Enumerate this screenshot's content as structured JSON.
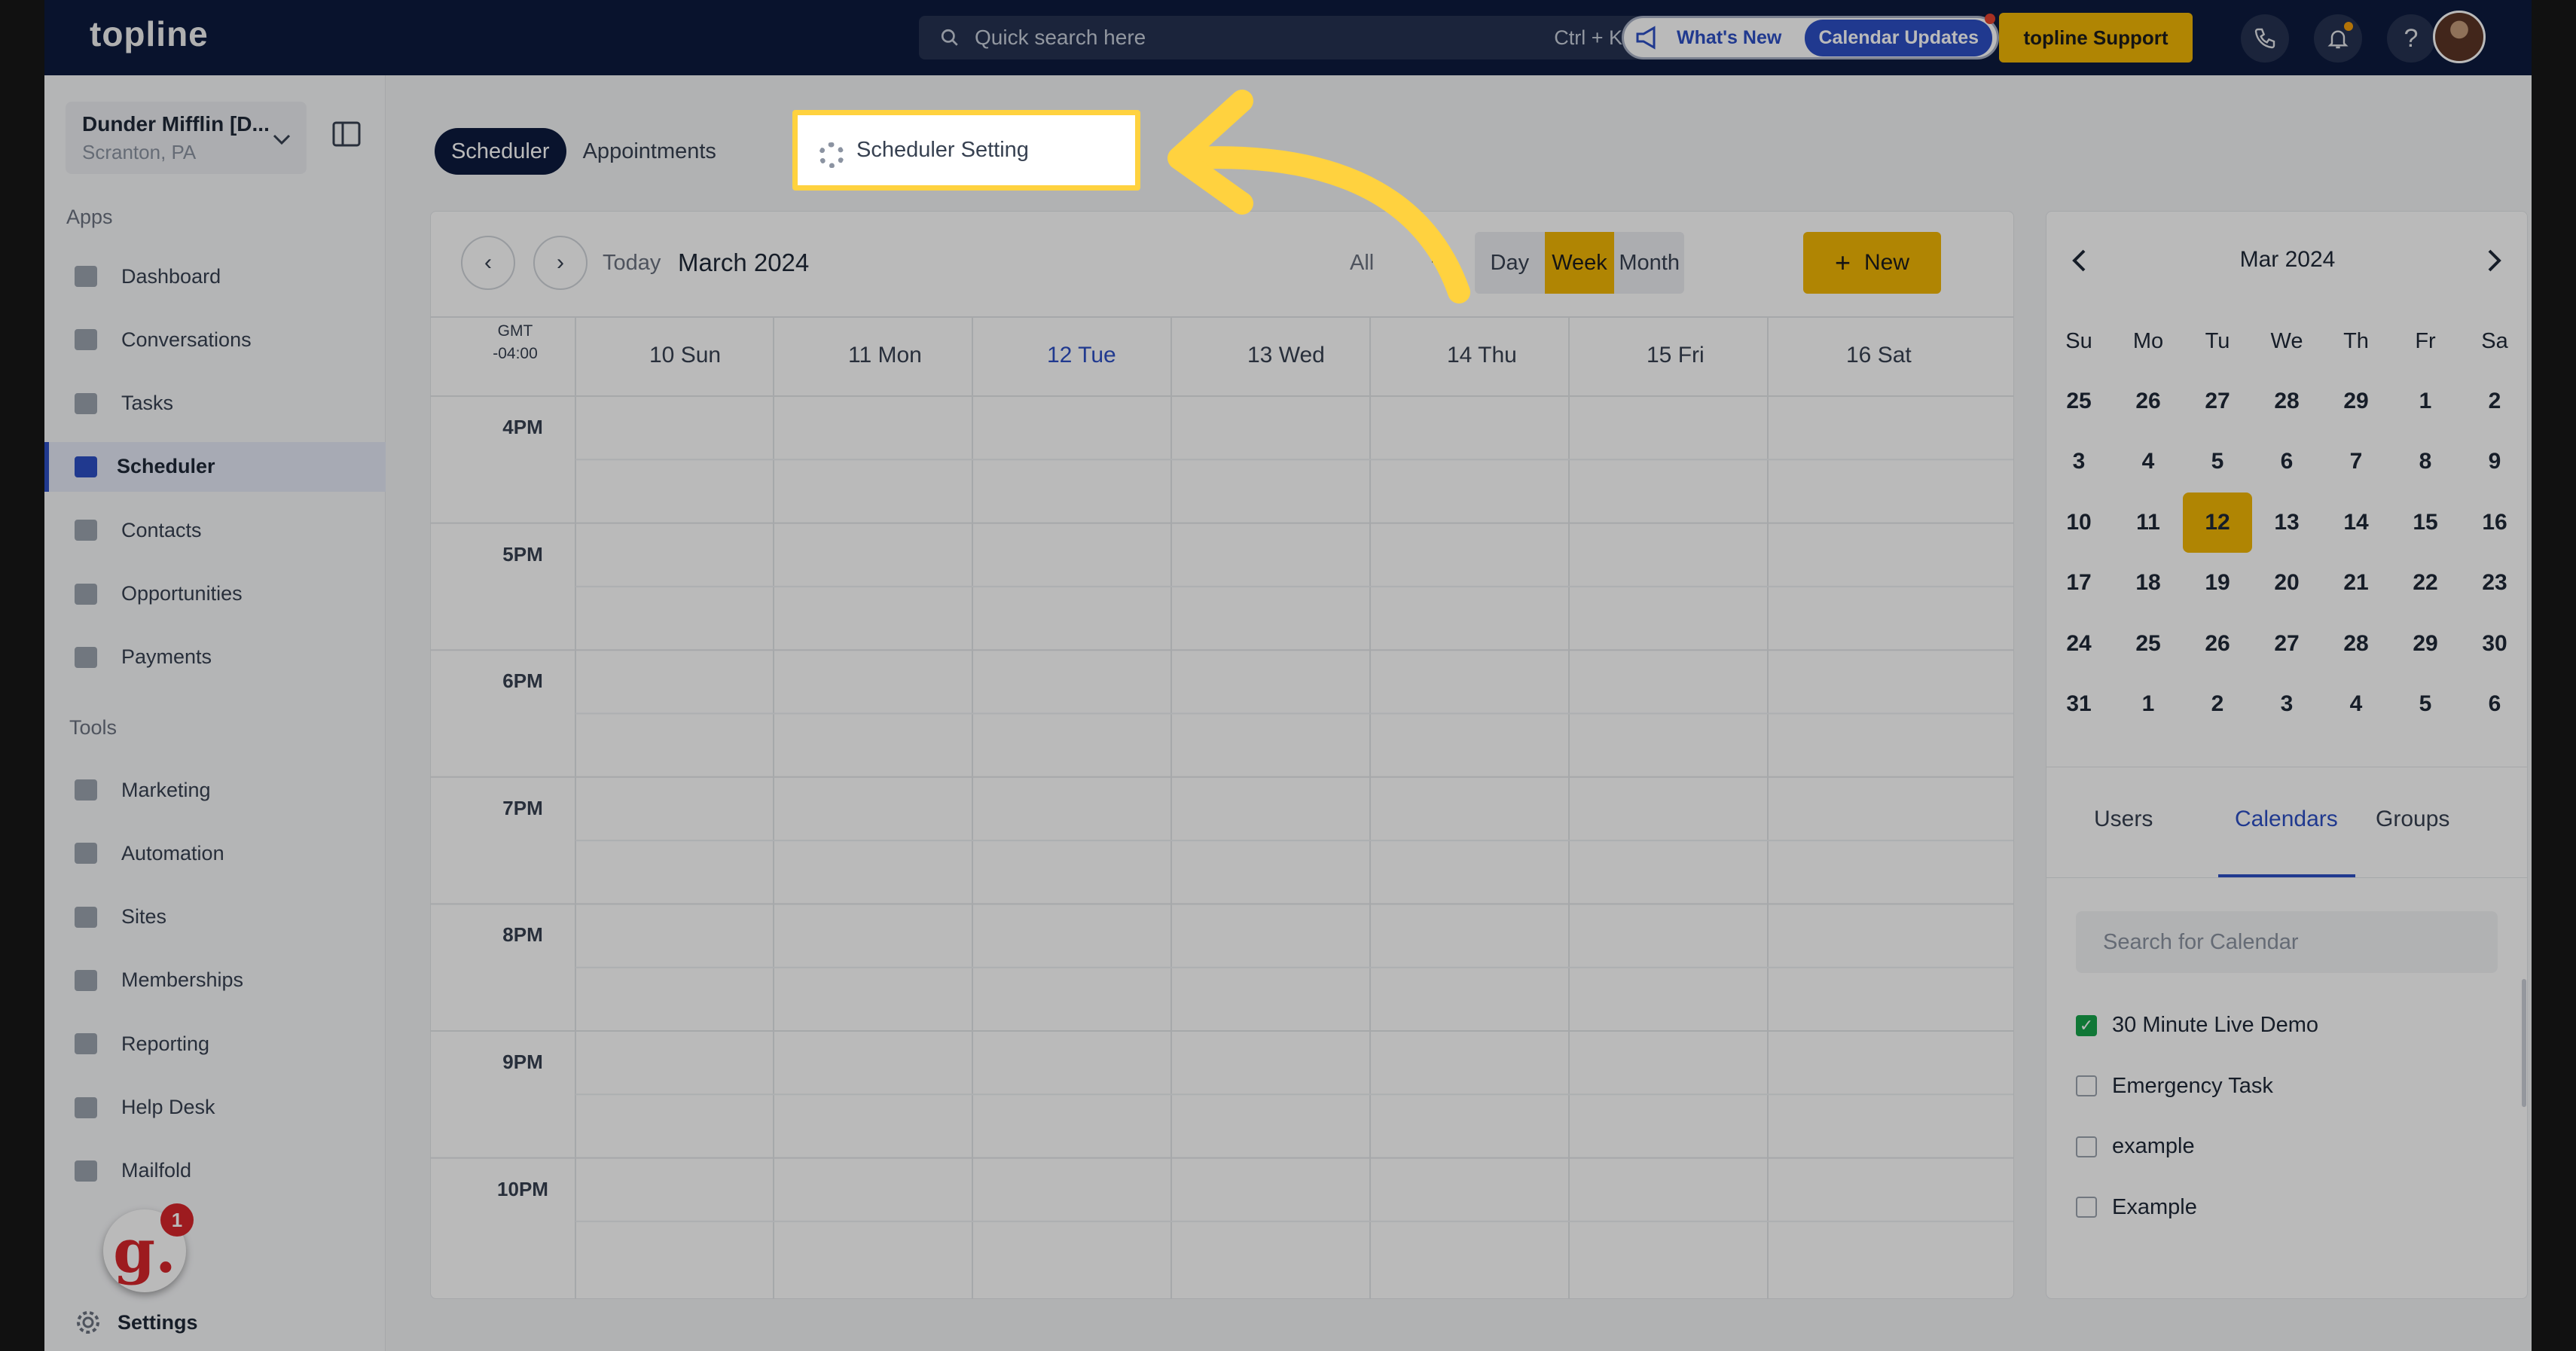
{
  "topbar": {
    "logo": "topline",
    "search_placeholder": "Quick search here",
    "search_shortcut": "Ctrl + K",
    "whats_new": "What's New",
    "calendar_updates": "Calendar Updates",
    "support": "topline Support"
  },
  "sidebar": {
    "location_name": "Dunder Mifflin [D...",
    "location_city": "Scranton, PA",
    "apps_heading": "Apps",
    "tools_heading": "Tools",
    "apps": [
      {
        "label": "Dashboard",
        "icon": "dashboard-icon"
      },
      {
        "label": "Conversations",
        "icon": "chat-icon"
      },
      {
        "label": "Tasks",
        "icon": "tasks-icon"
      },
      {
        "label": "Scheduler",
        "icon": "calendar-icon",
        "active": true
      },
      {
        "label": "Contacts",
        "icon": "user-icon"
      },
      {
        "label": "Opportunities",
        "icon": "target-icon"
      },
      {
        "label": "Payments",
        "icon": "card-icon"
      }
    ],
    "tools": [
      {
        "label": "Marketing",
        "icon": "megaphone-icon"
      },
      {
        "label": "Automation",
        "icon": "gears-icon"
      },
      {
        "label": "Sites",
        "icon": "globe-icon"
      },
      {
        "label": "Memberships",
        "icon": "people-icon"
      },
      {
        "label": "Reporting",
        "icon": "pie-chart-icon"
      },
      {
        "label": "Help Desk",
        "icon": "help-icon"
      },
      {
        "label": "Mailfold",
        "icon": "mail-icon"
      }
    ],
    "settings": "Settings",
    "notification_count": "1",
    "badge_letter": "g."
  },
  "main": {
    "tabs": [
      "Scheduler",
      "Appointments",
      "Scheduler Setting"
    ],
    "today": "Today",
    "month_label": "March 2024",
    "filter": "All",
    "views": [
      "Day",
      "Week",
      "Month"
    ],
    "active_view": "Week",
    "new_button": "New",
    "timezone": [
      "GMT",
      "-04:00"
    ],
    "days": [
      "10 Sun",
      "11 Mon",
      "12 Tue",
      "13 Wed",
      "14 Thu",
      "15 Fri",
      "16 Sat"
    ],
    "today_column": "12 Tue",
    "times": [
      "4PM",
      "5PM",
      "6PM",
      "7PM",
      "8PM",
      "9PM",
      "10PM"
    ]
  },
  "mini_calendar": {
    "title": "Mar 2024",
    "weekdays": [
      "Su",
      "Mo",
      "Tu",
      "We",
      "Th",
      "Fr",
      "Sa"
    ],
    "weeks": [
      [
        "25",
        "26",
        "27",
        "28",
        "29",
        "1",
        "2"
      ],
      [
        "3",
        "4",
        "5",
        "6",
        "7",
        "8",
        "9"
      ],
      [
        "10",
        "11",
        "12",
        "13",
        "14",
        "15",
        "16"
      ],
      [
        "17",
        "18",
        "19",
        "20",
        "21",
        "22",
        "23"
      ],
      [
        "24",
        "25",
        "26",
        "27",
        "28",
        "29",
        "30"
      ],
      [
        "31",
        "1",
        "2",
        "3",
        "4",
        "5",
        "6"
      ]
    ],
    "selected": "12"
  },
  "panel": {
    "tabs": [
      "Users",
      "Calendars",
      "Groups"
    ],
    "active_tab": "Calendars",
    "search_placeholder": "Search for Calendar",
    "calendars": [
      {
        "label": "30 Minute Live Demo",
        "checked": true
      },
      {
        "label": "Emergency Task",
        "checked": false
      },
      {
        "label": "example",
        "checked": false
      },
      {
        "label": "Example",
        "checked": false
      }
    ]
  },
  "colors": {
    "accent": "#f2b705",
    "navy": "#0d1b3e",
    "blue": "#2c4fc4",
    "highlight": "#ffd23f"
  }
}
